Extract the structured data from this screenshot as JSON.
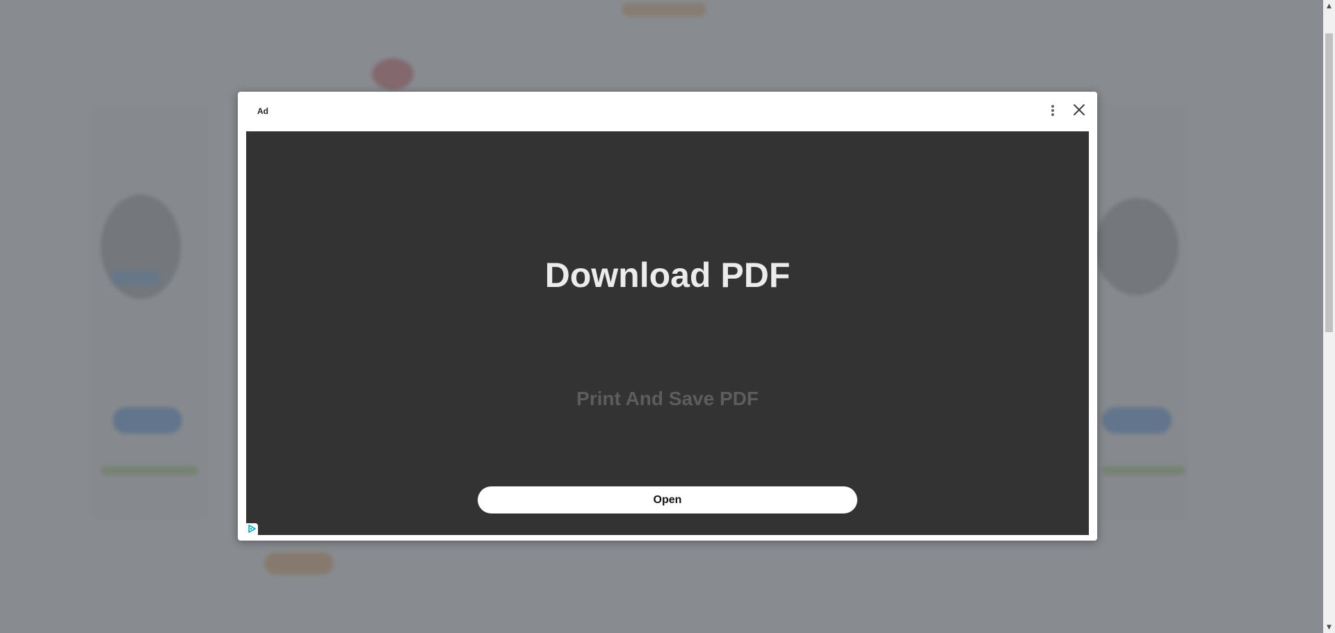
{
  "ad": {
    "label": "Ad",
    "headline": "Download PDF",
    "subheadline": "Print And Save PDF",
    "cta_label": "Open",
    "more_icon": "more-vert-icon",
    "close_icon": "close-icon",
    "adchoices_icon": "adchoices-icon"
  },
  "colors": {
    "overlay": "#6e7176",
    "creative_background": "#333333",
    "headline": "#ececec",
    "subheadline": "#5d5d5d",
    "cta_background": "#ffffff"
  }
}
